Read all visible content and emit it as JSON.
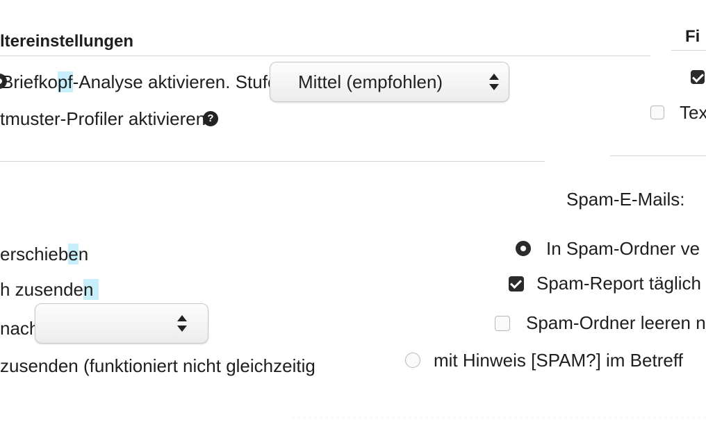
{
  "left_section": {
    "header": "ltereinstellungen",
    "brief_prefix": "Briefko",
    "brief_highlight": "pf",
    "brief_suffix": "-Analyse aktivieren. Stufe:",
    "level_select_value": "Mittel (empfohlen)",
    "textmuster_label": "tmuster-Profiler aktivieren",
    "help_glyph": "?"
  },
  "actions": {
    "move_prefix": "erschieb",
    "move_highlight": "e",
    "move_suffix": "n",
    "daily_text": "h zusende",
    "daily_highlight": "n",
    "after_label": "nach:",
    "after_select_value": "",
    "send_notice": "zusenden (funktioniert nicht gleichzeitig"
  },
  "right_section": {
    "header": "Fi",
    "textmuster_label": "Text",
    "spam_label": "Spam-E-Mails:",
    "option_move": "In Spam-Ordner ve",
    "option_report": "Spam-Report täglich",
    "option_empty": "Spam-Ordner leeren n",
    "option_subject": "mit Hinweis [SPAM?] im Betreff"
  },
  "colors": {
    "highlight": "#c7eefb",
    "checked": "#2b2b2b",
    "divider": "#d5d5d5"
  }
}
